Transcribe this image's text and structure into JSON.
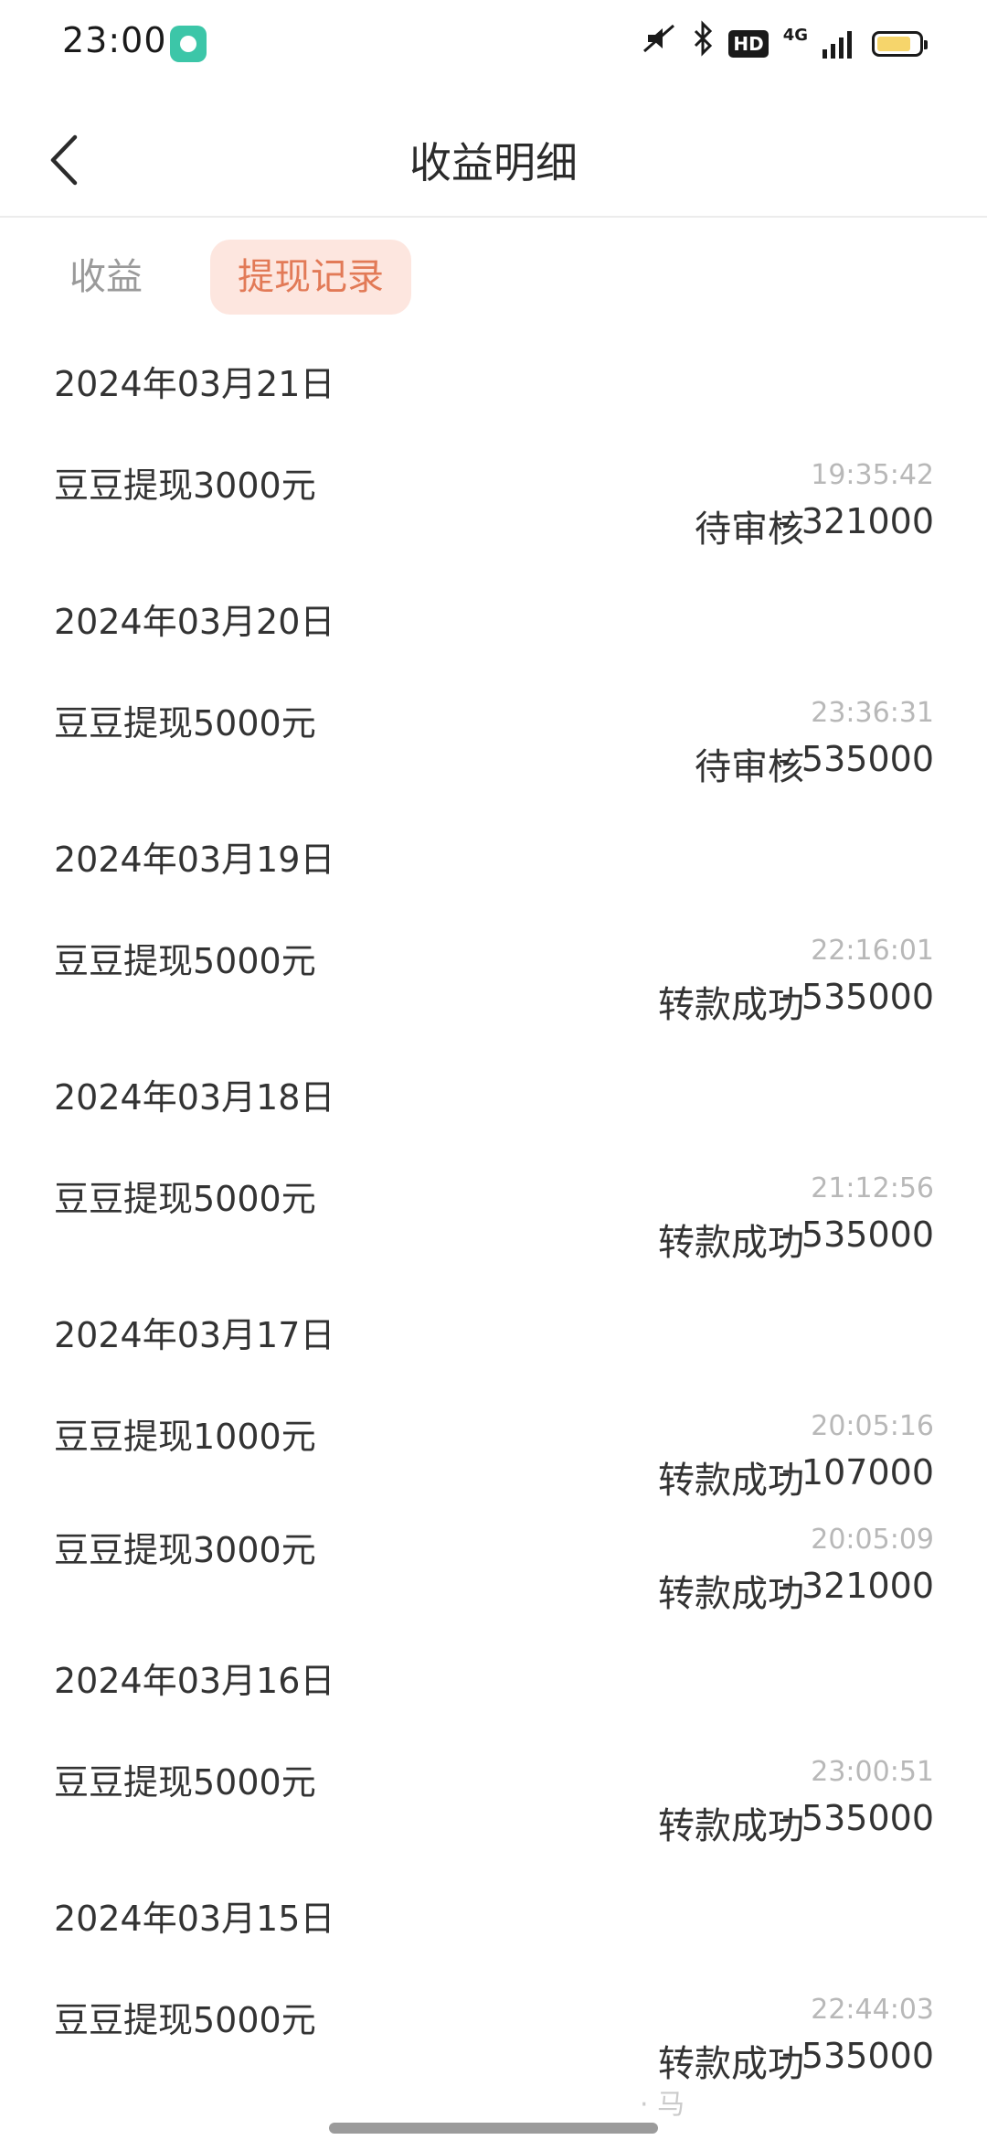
{
  "status_bar": {
    "time": "23:00",
    "network": "4G",
    "hd": "HD",
    "icons": [
      "app-icon",
      "mute-icon",
      "bluetooth-icon",
      "hd-icon",
      "signal-icon",
      "battery-icon"
    ]
  },
  "header": {
    "title": "收益明细",
    "back_icon": "chevron-left-icon"
  },
  "tabs": [
    {
      "label": "收益",
      "active": false
    },
    {
      "label": "提现记录",
      "active": true
    }
  ],
  "colors": {
    "accent": "#e27a57",
    "accent_bg": "#fde6df",
    "muted_time": "#b8b8b8"
  },
  "groups": [
    {
      "date": "2024年03月21日",
      "records": [
        {
          "title": "豆豆提现3000元",
          "time": "19:35:42",
          "status": "待审核",
          "amount": "- 321000"
        }
      ]
    },
    {
      "date": "2024年03月20日",
      "records": [
        {
          "title": "豆豆提现5000元",
          "time": "23:36:31",
          "status": "待审核",
          "amount": "- 535000"
        }
      ]
    },
    {
      "date": "2024年03月19日",
      "records": [
        {
          "title": "豆豆提现5000元",
          "time": "22:16:01",
          "status": "转款成功",
          "amount": "- 535000"
        }
      ]
    },
    {
      "date": "2024年03月18日",
      "records": [
        {
          "title": "豆豆提现5000元",
          "time": "21:12:56",
          "status": "转款成功",
          "amount": "- 535000"
        }
      ]
    },
    {
      "date": "2024年03月17日",
      "records": [
        {
          "title": "豆豆提现1000元",
          "time": "20:05:16",
          "status": "转款成功",
          "amount": "- 107000"
        },
        {
          "title": "豆豆提现3000元",
          "time": "20:05:09",
          "status": "转款成功",
          "amount": "- 321000"
        }
      ]
    },
    {
      "date": "2024年03月16日",
      "records": [
        {
          "title": "豆豆提现5000元",
          "time": "23:00:51",
          "status": "转款成功",
          "amount": "- 535000"
        }
      ]
    },
    {
      "date": "2024年03月15日",
      "records": [
        {
          "title": "豆豆提现5000元",
          "time": "22:44:03",
          "status": "转款成功",
          "amount": "- 535000"
        }
      ]
    }
  ],
  "watermark": "· 马"
}
